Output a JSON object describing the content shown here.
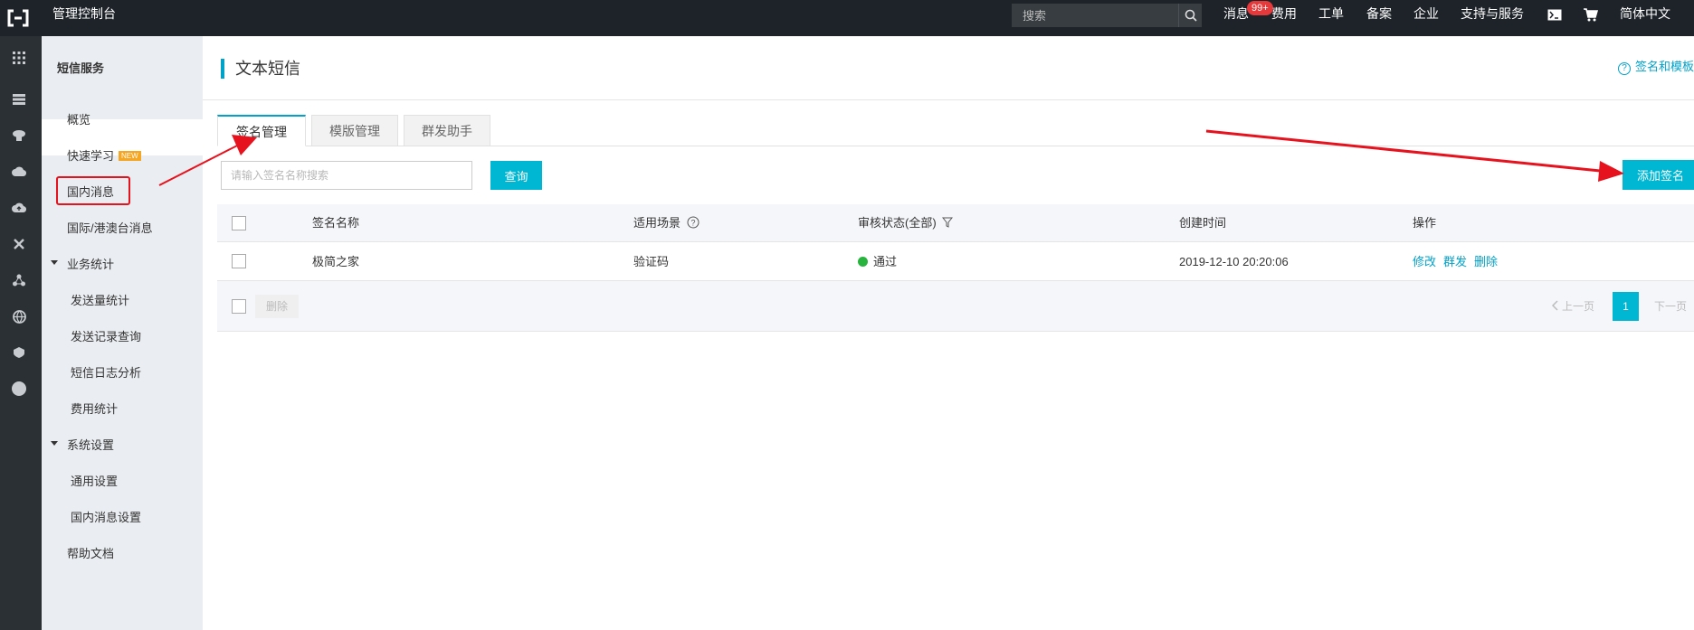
{
  "topbar": {
    "title": "管理控制台",
    "search_placeholder": "搜索",
    "nav": {
      "messages": "消息",
      "messages_badge": "99+",
      "billing": "费用",
      "tickets": "工单",
      "icp": "备案",
      "enterprise": "企业",
      "support": "支持与服务",
      "language": "简体中文"
    }
  },
  "sidebar": {
    "title": "短信服务",
    "items": {
      "overview": "概览",
      "quickstart": "快速学习",
      "quickstart_tag": "NEW",
      "domestic": "国内消息",
      "international": "国际/港澳台消息",
      "stats_group": "业务统计",
      "send_stats": "发送量统计",
      "send_records": "发送记录查询",
      "log_analysis": "短信日志分析",
      "cost_stats": "费用统计",
      "settings_group": "系统设置",
      "general_settings": "通用设置",
      "domestic_settings": "国内消息设置",
      "help_docs": "帮助文档"
    }
  },
  "main": {
    "title": "文本短信",
    "help_link": "签名和模板",
    "tabs": [
      "签名管理",
      "模版管理",
      "群发助手"
    ],
    "search_placeholder": "请输入签名名称搜索",
    "query_button": "查询",
    "add_button": "添加签名",
    "table": {
      "headers": {
        "name": "签名名称",
        "scenario": "适用场景",
        "status": "审核状态(全部)",
        "created": "创建时间",
        "actions": "操作"
      },
      "rows": [
        {
          "name": "极简之家",
          "scenario": "验证码",
          "status": "通过",
          "created": "2019-12-10 20:20:06",
          "actions": [
            "修改",
            "群发",
            "删除"
          ]
        }
      ],
      "delete_button": "删除",
      "prev": "上一页",
      "page": "1",
      "next": "下一页"
    }
  },
  "colors": {
    "accent": "#00b7d3",
    "topbar": "#1e2329",
    "status_ok": "#28b33e",
    "annotation": "#e6121d"
  }
}
